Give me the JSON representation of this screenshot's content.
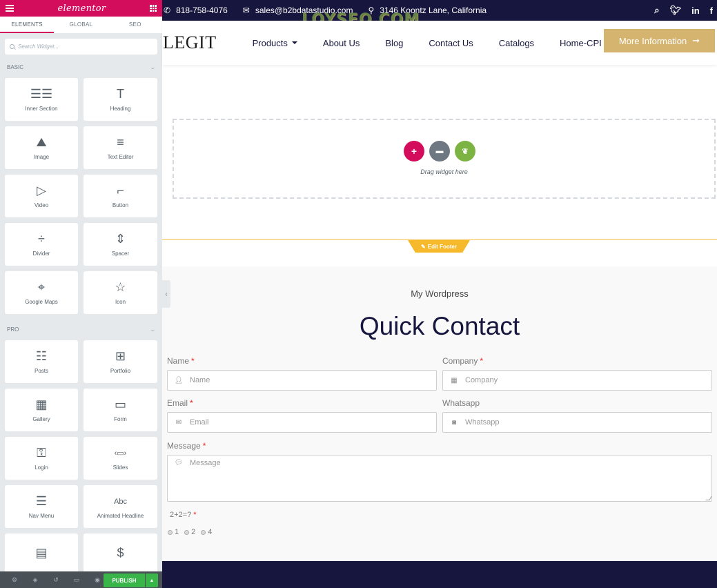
{
  "panel": {
    "logo": "elementor",
    "tabs": [
      "ELEMENTS",
      "GLOBAL",
      "SEO"
    ],
    "active_tab": "ELEMENTS",
    "search_placeholder": "Search Widget...",
    "categories": [
      {
        "name": "BASIC",
        "widgets": [
          {
            "label": "Inner Section",
            "icon": "columns-icon"
          },
          {
            "label": "Heading",
            "icon": "heading-icon"
          },
          {
            "label": "Image",
            "icon": "image-icon"
          },
          {
            "label": "Text Editor",
            "icon": "text-editor-icon"
          },
          {
            "label": "Video",
            "icon": "video-icon"
          },
          {
            "label": "Button",
            "icon": "button-icon"
          },
          {
            "label": "Divider",
            "icon": "divider-icon"
          },
          {
            "label": "Spacer",
            "icon": "spacer-icon"
          },
          {
            "label": "Google Maps",
            "icon": "google-maps-icon"
          },
          {
            "label": "Icon",
            "icon": "star-icon"
          }
        ]
      },
      {
        "name": "PRO",
        "widgets": [
          {
            "label": "Posts",
            "icon": "posts-icon"
          },
          {
            "label": "Portfolio",
            "icon": "portfolio-icon"
          },
          {
            "label": "Gallery",
            "icon": "gallery-icon"
          },
          {
            "label": "Form",
            "icon": "form-icon"
          },
          {
            "label": "Login",
            "icon": "login-icon"
          },
          {
            "label": "Slides",
            "icon": "slides-icon"
          },
          {
            "label": "Nav Menu",
            "icon": "nav-menu-icon"
          },
          {
            "label": "Animated Headline",
            "icon": "animated-headline-icon"
          },
          {
            "label": "",
            "icon": "price-list-icon"
          },
          {
            "label": "",
            "icon": "price-table-icon"
          }
        ]
      }
    ],
    "footer": {
      "publish_label": "PUBLISH",
      "icons": [
        "settings-icon",
        "navigator-icon",
        "history-icon",
        "responsive-icon",
        "preview-icon"
      ]
    }
  },
  "site": {
    "topbar": {
      "phone": "818-758-4076",
      "email": "sales@b2bdatastudio.com",
      "address": "3146 Koontz Lane, California",
      "watermark": "LOYSEO.COM"
    },
    "brand": "LEGIT",
    "nav": [
      "Products",
      "About Us",
      "Blog",
      "Contact Us",
      "Catalogs",
      "Home-CPI"
    ],
    "cta_label": "More Information",
    "dropzone_text": "Drag widget here",
    "edit_footer_label": "Edit Footer",
    "colors": {
      "primary": "#17163e",
      "accent": "#d4b46f",
      "elementor": "#d30c5c",
      "publish": "#39b54a"
    }
  },
  "form": {
    "subtitle": "My Wordpress",
    "title": "Quick Contact",
    "fields": {
      "name": {
        "label": "Name",
        "placeholder": "Name",
        "required": "*"
      },
      "company": {
        "label": "Company",
        "placeholder": "Company",
        "required": "*"
      },
      "email": {
        "label": "Email",
        "placeholder": "Email",
        "required": "*"
      },
      "whatsapp": {
        "label": "Whatsapp",
        "placeholder": "Whatsapp"
      },
      "message": {
        "label": "Message",
        "placeholder": "Message",
        "required": "*"
      }
    },
    "captcha": {
      "question": "2+2=?",
      "required": "*",
      "options": [
        "1",
        "2",
        "4"
      ]
    }
  }
}
